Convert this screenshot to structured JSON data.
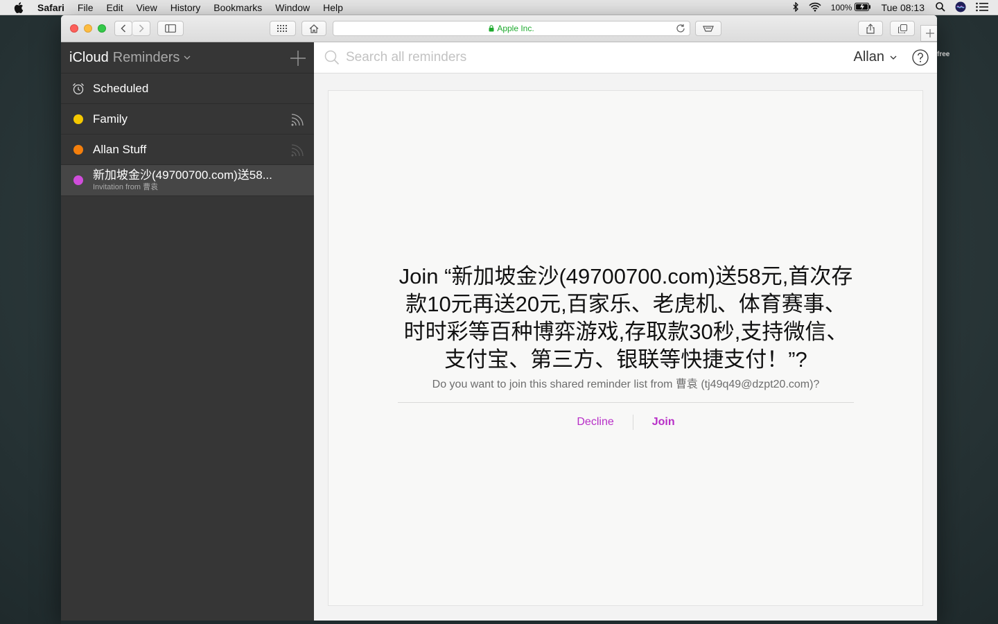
{
  "menubar": {
    "app_name": "Safari",
    "menus": [
      "File",
      "Edit",
      "View",
      "History",
      "Bookmarks",
      "Window",
      "Help"
    ],
    "battery": "100%",
    "clock": "Tue 08:13"
  },
  "browser": {
    "address": "Apple Inc.",
    "address_color": "#1eaa2e"
  },
  "sidebar": {
    "brand": "iCloud",
    "app": "Reminders",
    "items": [
      {
        "label": "Scheduled",
        "icon": "alarm-clock-icon"
      },
      {
        "label": "Family",
        "color": "#f5c800",
        "shared": true
      },
      {
        "label": "Allan Stuff",
        "color": "#f57f0c",
        "shared": true
      },
      {
        "label": "新加坡金沙(49700700.com)送58...",
        "sub": "Invitation from 曹袁",
        "color": "#d04ddb"
      }
    ]
  },
  "main": {
    "search_placeholder": "Search all reminders",
    "user": "Allan",
    "invite": {
      "title": "Join “新加坡金沙(49700700.com)送58元,首次存款10元再送20元,百家乐、老虎机、体育赛事、时时彩等百种博弈游戏,存取款30秒,支持微信、支付宝、第三方、银联等快捷支付！”?",
      "question": "Do you want to join this shared reminder list from 曹袁 (tj49q49@dzpt20.com)?",
      "decline": "Decline",
      "join": "Join",
      "accent": "#b72ec7"
    }
  },
  "desktop": {
    "free_label": "free"
  }
}
